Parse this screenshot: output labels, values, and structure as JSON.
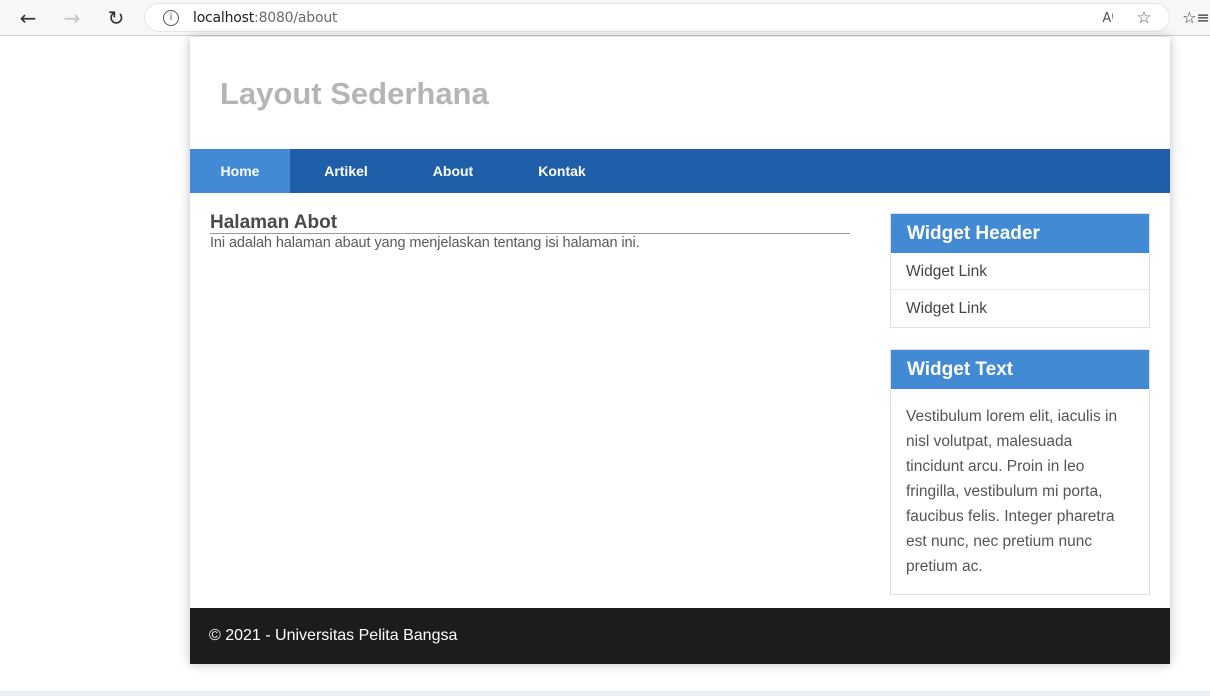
{
  "browser": {
    "url_host": "localhost",
    "url_rest": ":8080/about"
  },
  "header": {
    "title": "Layout Sederhana"
  },
  "nav": {
    "items": [
      {
        "label": "Home"
      },
      {
        "label": "Artikel"
      },
      {
        "label": "About"
      },
      {
        "label": "Kontak"
      }
    ]
  },
  "content": {
    "title": "Halaman Abot",
    "text": "Ini adalah halaman abaut yang menjelaskan tentang isi halaman ini."
  },
  "sidebar": {
    "widget_header": {
      "title": "Widget Header",
      "links": [
        "Widget Link",
        "Widget Link"
      ]
    },
    "widget_text": {
      "title": "Widget Text",
      "body": "Vestibulum lorem elit, iaculis in nisl volutpat, malesuada tincidunt arcu. Proin in leo fringilla, vestibulum mi porta, faucibus felis. Integer pharetra est nunc, nec pretium nunc pretium ac."
    }
  },
  "footer": {
    "text": "© 2021 - Universitas Pelita Bangsa"
  },
  "colors": {
    "nav_bg": "#1f5faa",
    "nav_active": "#428bd4",
    "widget_header": "#428bd4",
    "footer_bg": "#1c1c1c",
    "title": "#b5b5b5"
  }
}
